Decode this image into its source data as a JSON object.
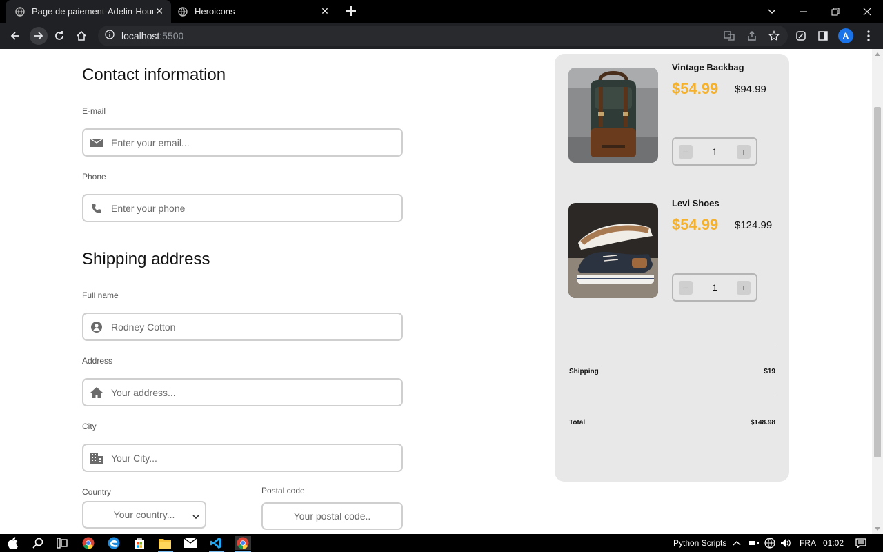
{
  "browser": {
    "tabs": [
      {
        "title": "Page de paiement-Adelin-Hounhouedo",
        "active": true
      },
      {
        "title": "Heroicons",
        "active": false
      }
    ],
    "address": {
      "host": "localhost",
      "port": ":5500"
    },
    "profile_initial": "A"
  },
  "contact": {
    "title": "Contact information",
    "email": {
      "label": "E-mail",
      "placeholder": "Enter your email...",
      "icon": "envelope-icon"
    },
    "phone": {
      "label": "Phone",
      "placeholder": "Enter your phone",
      "icon": "phone-icon"
    }
  },
  "shipping": {
    "title": "Shipping address",
    "fullname": {
      "label": "Full name",
      "value": "Rodney Cotton",
      "icon": "user-circle-icon"
    },
    "address": {
      "label": "Address",
      "placeholder": "Your address...",
      "icon": "home-icon"
    },
    "city": {
      "label": "City",
      "placeholder": "Your City...",
      "icon": "building-icon"
    },
    "country": {
      "label": "Country",
      "selected": "Your country..."
    },
    "postal": {
      "label": "Postal code",
      "placeholder": "Your postal code.."
    }
  },
  "cart": {
    "items": [
      {
        "name": "Vintage Backbag",
        "sale_price": "$54.99",
        "original_price": "$94.99",
        "quantity": "1",
        "image": "backpack-photo"
      },
      {
        "name": "Levi Shoes",
        "sale_price": "$54.99",
        "original_price": "$124.99",
        "quantity": "1",
        "image": "shoes-photo"
      }
    ],
    "qty_minus": "−",
    "qty_plus": "+",
    "shipping_label": "Shipping",
    "shipping_value": "$19",
    "total_label": "Total",
    "total_value": "$148.98"
  },
  "colors": {
    "accent_price": "#f5b12b",
    "panel_bg": "#e8e8e8",
    "chrome_bg": "#202124"
  },
  "taskbar": {
    "python_label": "Python Scripts",
    "lang": "FRA",
    "time": "01:02"
  }
}
